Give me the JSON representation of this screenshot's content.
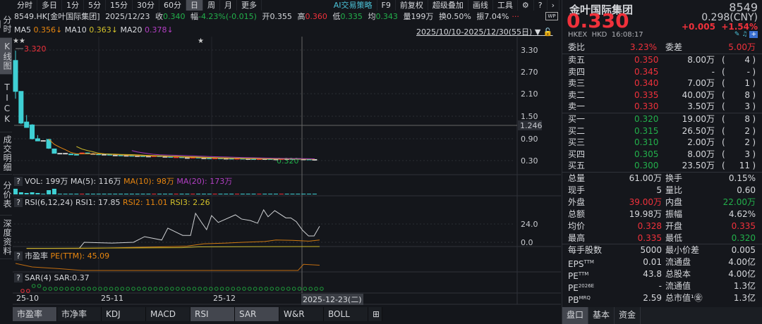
{
  "topbar": {
    "tabs": [
      "分时",
      "多日",
      "1分",
      "5分",
      "15分",
      "30分",
      "60分",
      "日",
      "周",
      "月",
      "更多"
    ],
    "active": 7,
    "right": [
      "AI交易策略",
      "F9",
      "前复权",
      "超级叠加",
      "画线",
      "工具"
    ]
  },
  "lefttabs": [
    "分时图",
    "K线图",
    "TICK",
    "成交明细",
    "分价表",
    "深度资料"
  ],
  "info": {
    "code": "8549.HK[金叶国际集团]",
    "date": "2025/12/23",
    "close_label": "收",
    "close": "0.340",
    "chg_label": "幅",
    "chg": "-4.23%(-0.015)",
    "open_label": "开",
    "open": "0.355",
    "high_label": "高",
    "high": "0.360",
    "low_label": "低",
    "low": "0.335",
    "avg_label": "均",
    "avg": "0.343",
    "vol_label": "量",
    "vol": "199万",
    "turn_label": "换",
    "turn": "0.50%",
    "amp_label": "振",
    "amp": "7.04%"
  },
  "ma": {
    "ma5_label": "MA5",
    "ma5": "0.356↓",
    "ma10_label": "MA10",
    "ma10": "0.363↓",
    "ma20_label": "MA20",
    "ma20": "0.378↓"
  },
  "range": "2025/10/10-2025/12/30(55日)",
  "main_chart": {
    "y_ticks": [
      "3.30",
      "2.70",
      "2.10",
      "1.50",
      "0.90",
      "0.30"
    ],
    "crosshair_value": "1.246",
    "max_label": "3.320",
    "min_label": "0.320",
    "stars": [
      "★★",
      "★"
    ]
  },
  "colors": {
    "up": "#f0313b",
    "down": "#3fd0d4",
    "ma5": "#e8860f",
    "ma10": "#c8b52a",
    "ma20": "#a236b8"
  },
  "candles": [
    [
      3.05,
      3.32,
      2.0,
      2.2
    ],
    [
      2.2,
      2.2,
      1.3,
      1.33
    ],
    [
      1.36,
      1.55,
      1.2,
      1.21
    ],
    [
      1.28,
      1.3,
      0.88,
      0.9
    ],
    [
      0.9,
      1.0,
      0.84,
      0.84
    ],
    [
      0.85,
      0.86,
      0.83,
      0.85
    ],
    [
      0.88,
      0.9,
      0.62,
      0.64
    ],
    [
      0.62,
      0.62,
      0.5,
      0.5
    ],
    [
      0.5,
      0.51,
      0.49,
      0.5
    ],
    [
      0.5,
      0.51,
      0.49,
      0.5
    ],
    [
      0.48,
      0.49,
      0.47,
      0.47
    ],
    [
      0.47,
      0.48,
      0.46,
      0.46
    ],
    [
      0.49,
      0.52,
      0.48,
      0.51
    ],
    [
      0.51,
      0.52,
      0.48,
      0.49
    ],
    [
      0.49,
      0.51,
      0.48,
      0.49
    ],
    [
      0.48,
      0.49,
      0.47,
      0.47
    ],
    [
      0.47,
      0.49,
      0.46,
      0.47
    ],
    [
      0.47,
      0.47,
      0.45,
      0.45
    ],
    [
      0.45,
      0.46,
      0.44,
      0.45
    ],
    [
      0.45,
      0.46,
      0.44,
      0.44
    ],
    [
      0.44,
      0.45,
      0.43,
      0.44
    ],
    [
      0.44,
      0.45,
      0.43,
      0.43
    ],
    [
      0.43,
      0.44,
      0.42,
      0.43
    ],
    [
      0.43,
      0.44,
      0.42,
      0.42
    ],
    [
      0.42,
      0.43,
      0.41,
      0.42
    ],
    [
      0.42,
      0.44,
      0.41,
      0.43
    ],
    [
      0.43,
      0.43,
      0.41,
      0.41
    ],
    [
      0.41,
      0.42,
      0.4,
      0.41
    ],
    [
      0.41,
      0.42,
      0.39,
      0.39
    ],
    [
      0.39,
      0.41,
      0.39,
      0.4
    ],
    [
      0.4,
      0.41,
      0.38,
      0.38
    ],
    [
      0.38,
      0.39,
      0.37,
      0.38
    ],
    [
      0.38,
      0.4,
      0.38,
      0.39
    ],
    [
      0.39,
      0.4,
      0.37,
      0.37
    ],
    [
      0.37,
      0.38,
      0.36,
      0.37
    ],
    [
      0.37,
      0.38,
      0.36,
      0.36
    ],
    [
      0.36,
      0.38,
      0.36,
      0.37
    ],
    [
      0.37,
      0.38,
      0.36,
      0.36
    ],
    [
      0.36,
      0.37,
      0.35,
      0.36
    ],
    [
      0.36,
      0.37,
      0.35,
      0.35
    ],
    [
      0.35,
      0.36,
      0.35,
      0.36
    ],
    [
      0.36,
      0.37,
      0.35,
      0.35
    ],
    [
      0.35,
      0.36,
      0.34,
      0.35
    ],
    [
      0.35,
      0.36,
      0.34,
      0.34
    ],
    [
      0.34,
      0.36,
      0.34,
      0.35
    ],
    [
      0.35,
      0.36,
      0.34,
      0.35
    ],
    [
      0.35,
      0.36,
      0.34,
      0.34
    ],
    [
      0.34,
      0.35,
      0.33,
      0.34
    ],
    [
      0.34,
      0.35,
      0.33,
      0.35
    ],
    [
      0.35,
      0.36,
      0.34,
      0.35
    ],
    [
      0.35,
      0.36,
      0.34,
      0.34
    ],
    [
      0.355,
      0.36,
      0.335,
      0.34
    ],
    [
      0.34,
      0.35,
      0.33,
      0.34
    ],
    [
      0.34,
      0.35,
      0.32,
      0.33
    ],
    [
      0.33,
      0.34,
      0.32,
      0.33
    ]
  ],
  "vol": {
    "title": "VOL: 199万",
    "ma5": "MA(5): 116万",
    "ma10": "MA(10): 98万",
    "ma20": "MA(20): 173万"
  },
  "rsi": {
    "title": "RSI(6,12,24)",
    "rsi1": "RSI1: 17.85",
    "rsi2": "RSI2: 11.01",
    "rsi3": "RSI3: 2.26",
    "y_ticks": [
      "24.0",
      "0.0"
    ],
    "rsi1_pts": [
      [
        2,
        -8
      ],
      [
        11.5,
        -8
      ],
      [
        12.4,
        0
      ],
      [
        17.4,
        -1
      ],
      [
        21.3,
        0
      ],
      [
        23.3,
        7.4
      ],
      [
        26.4,
        3
      ],
      [
        27.5,
        18.5
      ],
      [
        30.2,
        9
      ],
      [
        31.6,
        9
      ],
      [
        32.5,
        38
      ],
      [
        33.5,
        27
      ],
      [
        34.5,
        16.6
      ],
      [
        35.4,
        35
      ],
      [
        36.6,
        26
      ],
      [
        39.7,
        36
      ],
      [
        40.8,
        30.5
      ],
      [
        42.4,
        28.5
      ],
      [
        43.7,
        25
      ],
      [
        44.8,
        42.5
      ],
      [
        45.6,
        33.5
      ],
      [
        46.8,
        41.5
      ],
      [
        48.8,
        32
      ],
      [
        49.7,
        32
      ],
      [
        50.7,
        27
      ],
      [
        51.8,
        16
      ],
      [
        52.9,
        8.3
      ],
      [
        53.9,
        8.3
      ],
      [
        54.9,
        21
      ]
    ],
    "rsi2_pts": [
      [
        2,
        -8
      ],
      [
        12,
        -8
      ],
      [
        26,
        -6
      ],
      [
        31,
        -5
      ],
      [
        34,
        -2
      ],
      [
        38,
        -1
      ],
      [
        41,
        0
      ],
      [
        45,
        1
      ],
      [
        47,
        3
      ],
      [
        50,
        2.5
      ],
      [
        53,
        1.5
      ],
      [
        54.9,
        3
      ]
    ],
    "rsi3_pts": [
      [
        2,
        -8
      ],
      [
        30,
        -7
      ],
      [
        33,
        -6
      ],
      [
        54.9,
        -5.5
      ]
    ]
  },
  "pe": {
    "title": "市盈率",
    "value": "PE(TTM): 45.09",
    "pts": [
      [
        0,
        52
      ],
      [
        3,
        48
      ],
      [
        8,
        46
      ],
      [
        12,
        44
      ],
      [
        25,
        44
      ],
      [
        51,
        44
      ],
      [
        52,
        51
      ],
      [
        54.9,
        50
      ]
    ]
  },
  "sar": {
    "title": "SAR(4)",
    "value": "SAR:0.37"
  },
  "dates": {
    "labels": [
      "25-10",
      "25-11",
      "25-12"
    ],
    "crosshair": "2025-12-23(二)"
  },
  "bottom_tabs": [
    "市盈率",
    "市净率",
    "KDJ",
    "MACD",
    "RSI",
    "SAR",
    "W&R",
    "BOLL",
    "⊞"
  ],
  "right": {
    "name": "金叶国际集团",
    "code": "8549",
    "price": "0.330",
    "cny": "0.298(CNY)",
    "chg": "+0.005",
    "pct": "+1.54%",
    "exch": "HKEX",
    "cur": "HKD",
    "time": "16:08:17",
    "wb_label": "委比",
    "wb": "3.23%",
    "wc_label": "委差",
    "wc": "5.00万",
    "asks": [
      [
        "卖五",
        "0.350",
        "8.00万",
        "4"
      ],
      [
        "卖四",
        "0.345",
        "-",
        "-"
      ],
      [
        "卖三",
        "0.340",
        "7.00万",
        "1"
      ],
      [
        "卖二",
        "0.335",
        "40.00万",
        "8"
      ],
      [
        "卖一",
        "0.330",
        "3.50万",
        "3"
      ]
    ],
    "bids": [
      [
        "买一",
        "0.320",
        "19.00万",
        "8"
      ],
      [
        "买二",
        "0.315",
        "26.50万",
        "2"
      ],
      [
        "买三",
        "0.310",
        "2.00万",
        "2"
      ],
      [
        "买四",
        "0.305",
        "8.00万",
        "3"
      ],
      [
        "买五",
        "0.300",
        "23.50万",
        "11"
      ]
    ],
    "stats": [
      [
        "总量",
        "61.00万",
        "",
        "换手",
        "0.15%",
        ""
      ],
      [
        "现手",
        "5",
        "",
        "量比",
        "0.60",
        ""
      ],
      [
        "外盘",
        "39.00万",
        "red",
        "内盘",
        "22.00万",
        "grn"
      ],
      [
        "总额",
        "19.98万",
        "",
        "振幅",
        "4.62%",
        ""
      ],
      [
        "均价",
        "0.328",
        "red",
        "开盘",
        "0.335",
        "red"
      ],
      [
        "最高",
        "0.335",
        "red",
        "最低",
        "0.320",
        "grn"
      ]
    ],
    "stats2": [
      [
        "每手股数",
        "5000",
        "最小价差",
        "0.005"
      ],
      [
        "EPS<sup>TTM</sup>",
        "0.01",
        "流通盘",
        "4.00亿"
      ],
      [
        "PE<sup>TTM</sup>",
        "43.8",
        "总股本",
        "4.00亿"
      ],
      [
        "PE<sup>2026E</sup>",
        "-",
        "流通值",
        "1.3亿"
      ],
      [
        "PB<sup>MRQ</sup>",
        "2.59",
        "总市值¹㊎",
        "1.3亿"
      ]
    ],
    "tabs": [
      "盘口",
      "基本",
      "资金"
    ]
  }
}
